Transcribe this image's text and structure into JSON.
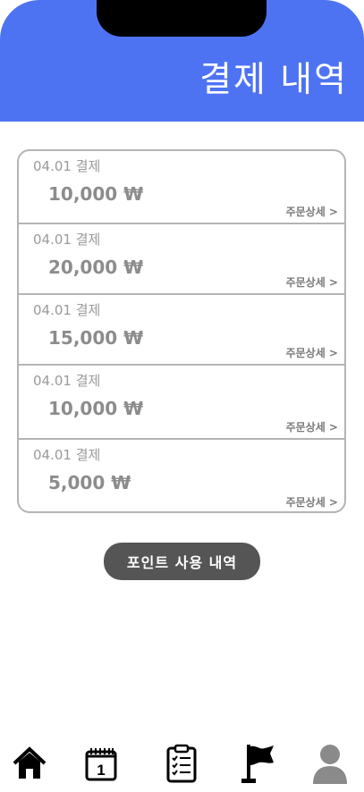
{
  "header": {
    "title": "결제 내역"
  },
  "payments": [
    {
      "date": "04.01 결제",
      "amount": "10,000 ₩",
      "detail": "주문상세 >"
    },
    {
      "date": "04.01 결제",
      "amount": "20,000 ₩",
      "detail": "주문상세 >"
    },
    {
      "date": "04.01 결제",
      "amount": "15,000 ₩",
      "detail": "주문상세 >"
    },
    {
      "date": "04.01 결제",
      "amount": "10,000 ₩",
      "detail": "주문상세 >"
    },
    {
      "date": "04.01 결제",
      "amount": "5,000 ₩",
      "detail": "주문상세 >"
    }
  ],
  "points_button": "포인트 사용 내역",
  "nav": {
    "items": [
      {
        "icon": "home-icon"
      },
      {
        "icon": "calendar-icon",
        "text": "1"
      },
      {
        "icon": "checklist-icon"
      },
      {
        "icon": "flag-icon"
      },
      {
        "icon": "profile-icon"
      }
    ]
  },
  "colors": {
    "header": "#4d73f3",
    "button": "#555555",
    "border": "#b4b4b4"
  }
}
